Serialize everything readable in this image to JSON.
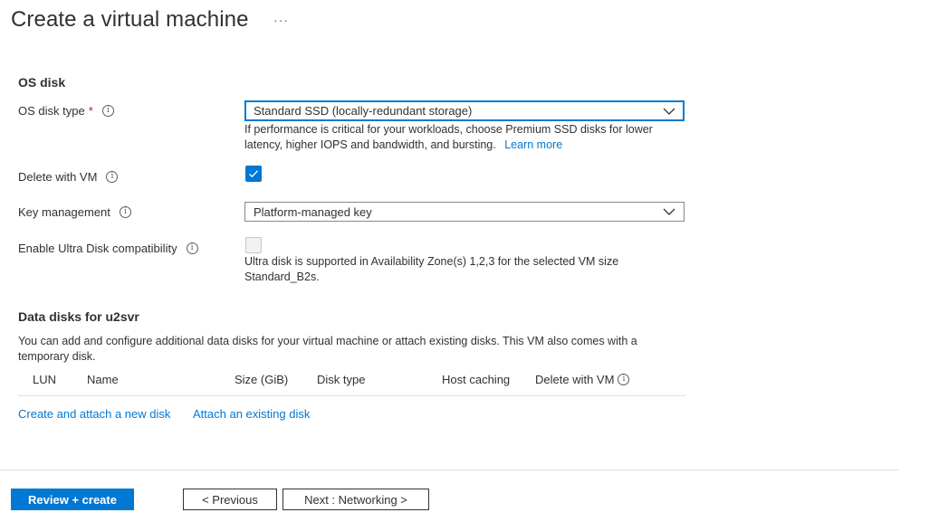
{
  "header": {
    "title": "Create a virtual machine",
    "more_label": "···"
  },
  "os_disk": {
    "section_title": "OS disk",
    "disk_type": {
      "label": "OS disk type",
      "required_mark": "*",
      "value": "Standard SSD (locally-redundant storage)",
      "help_text_line1": "If performance is critical for your workloads, choose Premium SSD disks for lower",
      "help_text_line2": "latency, higher IOPS and bandwidth, and bursting.",
      "learn_more": "Learn more"
    },
    "delete_with_vm": {
      "label": "Delete with VM",
      "checked": true
    },
    "key_management": {
      "label": "Key management",
      "value": "Platform-managed key"
    },
    "ultra_disk": {
      "label": "Enable Ultra Disk compatibility",
      "checked": false,
      "help_text_line1": "Ultra disk is supported in Availability Zone(s) 1,2,3 for the selected VM size",
      "help_text_line2": "Standard_B2s."
    }
  },
  "data_disks": {
    "section_title": "Data disks for u2svr",
    "description_line1": "You can add and configure additional data disks for your virtual machine or attach existing disks. This VM also comes with a",
    "description_line2": "temporary disk.",
    "columns": [
      "LUN",
      "Name",
      "Size (GiB)",
      "Disk type",
      "Host caching",
      "Delete with VM"
    ],
    "create_link": "Create and attach a new disk",
    "attach_link": "Attach an existing disk"
  },
  "footer": {
    "review_create": "Review + create",
    "previous": "< Previous",
    "next": "Next : Networking >"
  },
  "colors": {
    "accent": "#0078d4",
    "text": "#323130",
    "required": "#a4262c"
  }
}
